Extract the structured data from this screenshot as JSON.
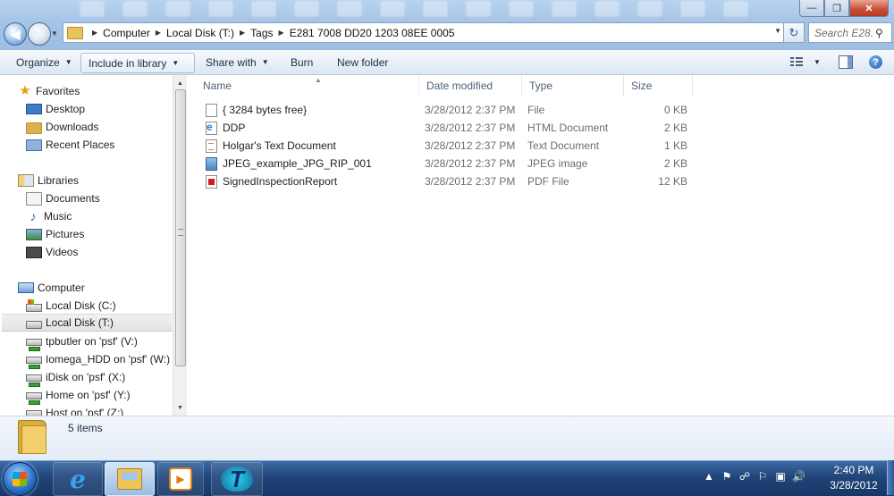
{
  "window": {
    "controls": {
      "minimize": "—",
      "maximize": "❐",
      "close": "✕"
    }
  },
  "nav": {
    "back_icon": "back-arrow-icon",
    "forward_icon": "forward-arrow-icon",
    "breadcrumb": [
      "Computer",
      "Local Disk (T:)",
      "Tags",
      "E281 7008 DD20 1203 08EE 0005"
    ],
    "search_placeholder": "Search E28...",
    "refresh_glyph": "↻"
  },
  "toolbar": {
    "organize": "Organize",
    "include": "Include in library",
    "share": "Share with",
    "burn": "Burn",
    "new_folder": "New folder"
  },
  "sidebar": {
    "favorites": {
      "label": "Favorites",
      "items": [
        "Desktop",
        "Downloads",
        "Recent Places"
      ]
    },
    "libraries": {
      "label": "Libraries",
      "items": [
        "Documents",
        "Music",
        "Pictures",
        "Videos"
      ]
    },
    "computer": {
      "label": "Computer",
      "items": [
        "Local Disk (C:)",
        "Local Disk (T:)",
        "tpbutler on 'psf' (V:)",
        "Iomega_HDD on 'psf' (W:)",
        "iDisk on 'psf' (X:)",
        "Home on 'psf' (Y:)",
        "Host on 'psf' (Z:)"
      ],
      "selected": "Local Disk (T:)"
    }
  },
  "columns": [
    "Name",
    "Date modified",
    "Type",
    "Size"
  ],
  "files": [
    {
      "name": "{ 3284 bytes free}",
      "date": "3/28/2012 2:37 PM",
      "type": "File",
      "size": "0 KB",
      "icon": "blank-file-icon"
    },
    {
      "name": "DDP",
      "date": "3/28/2012 2:37 PM",
      "type": "HTML Document",
      "size": "2 KB",
      "icon": "html-file-icon"
    },
    {
      "name": "Holgar's Text Document",
      "date": "3/28/2012 2:37 PM",
      "type": "Text Document",
      "size": "1 KB",
      "icon": "text-file-icon"
    },
    {
      "name": "JPEG_example_JPG_RIP_001",
      "date": "3/28/2012 2:37 PM",
      "type": "JPEG image",
      "size": "2 KB",
      "icon": "jpeg-file-icon"
    },
    {
      "name": "SignedInspectionReport",
      "date": "3/28/2012 2:37 PM",
      "type": "PDF File",
      "size": "12 KB",
      "icon": "pdf-file-icon"
    }
  ],
  "status": {
    "item_count": "5 items"
  },
  "taskbar": {
    "time": "2:40 PM",
    "date": "3/28/2012",
    "tray_glyphs": [
      "▲",
      "⚑",
      "☍",
      "⚐",
      "▣",
      "🔊"
    ]
  }
}
